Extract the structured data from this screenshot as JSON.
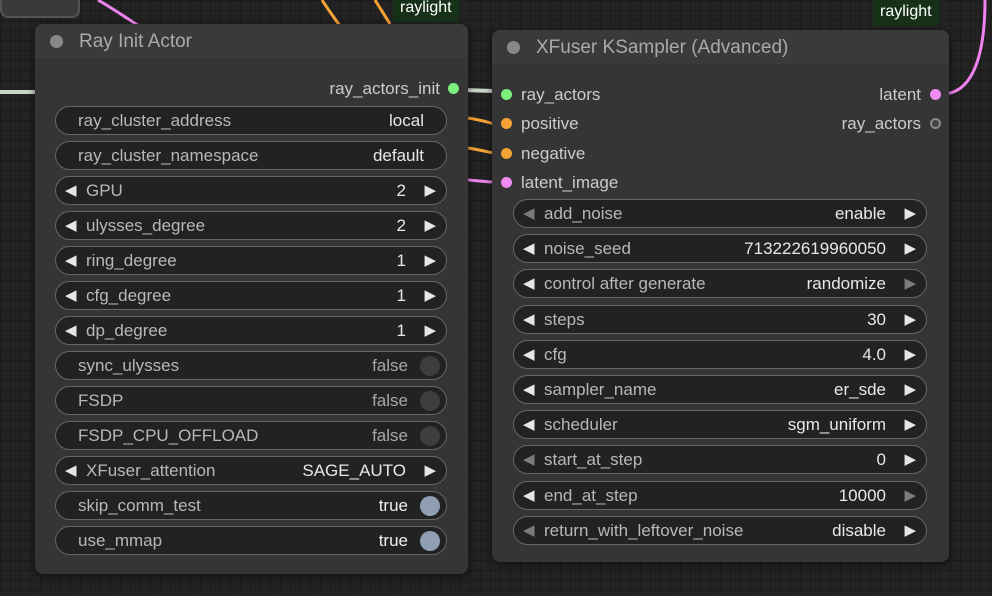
{
  "colors": {
    "canvas_bg": "#232323",
    "node_bg": "#353535",
    "widget_bg": "#222222",
    "group_label_bg": "#173119",
    "link_latent": "#ee82ee",
    "link_conditioning": "#f5a236",
    "link_ray": "#c9d6c9",
    "slot_green": "#7cf07c",
    "slot_orange": "#f5a236",
    "slot_pink": "#f08cf0",
    "slot_gray": "#888888",
    "toggle_on": "#8f9eb3"
  },
  "canvas": {
    "group_labels": [
      "raylight",
      "raylight"
    ]
  },
  "ray_init_actor": {
    "title": "Ray Init Actor",
    "outputs": [
      {
        "label": "ray_actors_init",
        "color": "#7cf07c"
      }
    ],
    "widgets": [
      {
        "name": "ray_cluster_address",
        "value": "local",
        "kind": "text"
      },
      {
        "name": "ray_cluster_namespace",
        "value": "default",
        "kind": "text"
      },
      {
        "name": "GPU",
        "value": "2",
        "kind": "number"
      },
      {
        "name": "ulysses_degree",
        "value": "2",
        "kind": "number"
      },
      {
        "name": "ring_degree",
        "value": "1",
        "kind": "number"
      },
      {
        "name": "cfg_degree",
        "value": "1",
        "kind": "number"
      },
      {
        "name": "dp_degree",
        "value": "1",
        "kind": "number"
      },
      {
        "name": "sync_ulysses",
        "value": "false",
        "kind": "toggle",
        "on": false
      },
      {
        "name": "FSDP",
        "value": "false",
        "kind": "toggle",
        "on": false
      },
      {
        "name": "FSDP_CPU_OFFLOAD",
        "value": "false",
        "kind": "toggle",
        "on": false
      },
      {
        "name": "XFuser_attention",
        "value": "SAGE_AUTO",
        "kind": "combo"
      },
      {
        "name": "skip_comm_test",
        "value": "true",
        "kind": "toggle",
        "on": true
      },
      {
        "name": "use_mmap",
        "value": "true",
        "kind": "toggle",
        "on": true
      }
    ]
  },
  "xfuser_ksampler": {
    "title": "XFuser KSampler (Advanced)",
    "inputs": [
      {
        "label": "ray_actors",
        "color": "#7cf07c"
      },
      {
        "label": "positive",
        "color": "#f5a236"
      },
      {
        "label": "negative",
        "color": "#f5a236"
      },
      {
        "label": "latent_image",
        "color": "#f08cf0"
      }
    ],
    "outputs": [
      {
        "label": "latent",
        "color": "#f08cf0"
      },
      {
        "label": "ray_actors",
        "color": "#888888"
      }
    ],
    "widgets": [
      {
        "name": "add_noise",
        "value": "enable",
        "left_dim": true,
        "right_dim": false
      },
      {
        "name": "noise_seed",
        "value": "713222619960050",
        "left_dim": false,
        "right_dim": false
      },
      {
        "name": "control after generate",
        "value": "randomize",
        "left_dim": false,
        "right_dim": true
      },
      {
        "name": "steps",
        "value": "30",
        "left_dim": false,
        "right_dim": false
      },
      {
        "name": "cfg",
        "value": "4.0",
        "left_dim": false,
        "right_dim": false
      },
      {
        "name": "sampler_name",
        "value": "er_sde",
        "left_dim": false,
        "right_dim": false
      },
      {
        "name": "scheduler",
        "value": "sgm_uniform",
        "left_dim": false,
        "right_dim": false
      },
      {
        "name": "start_at_step",
        "value": "0",
        "left_dim": true,
        "right_dim": false
      },
      {
        "name": "end_at_step",
        "value": "10000",
        "left_dim": false,
        "right_dim": true
      },
      {
        "name": "return_with_leftover_noise",
        "value": "disable",
        "left_dim": true,
        "right_dim": false
      }
    ]
  }
}
